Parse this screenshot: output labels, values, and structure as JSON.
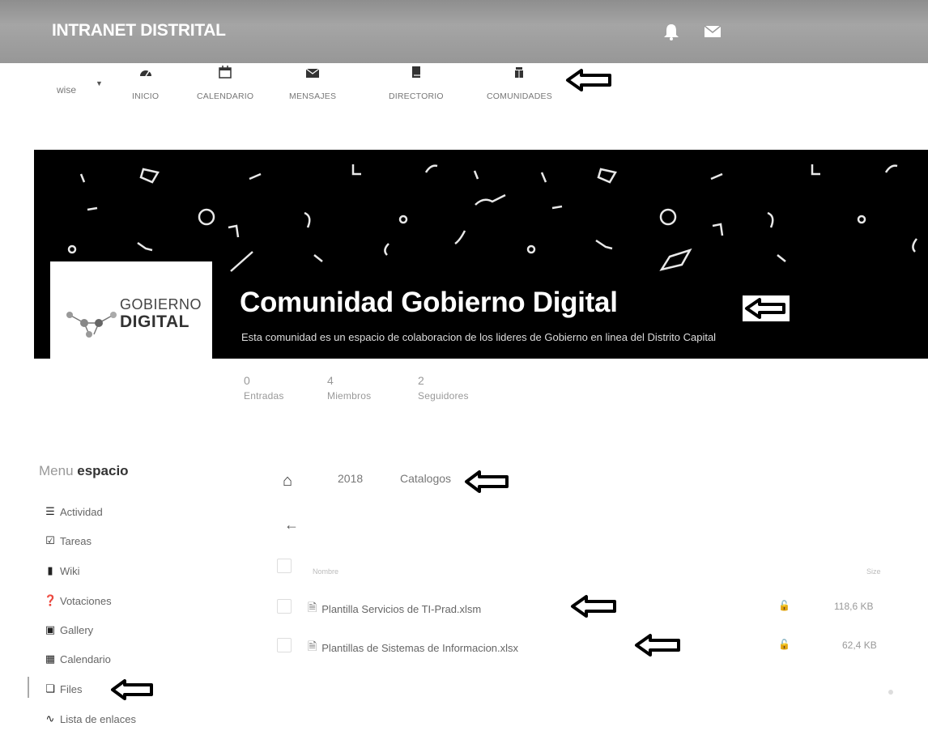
{
  "header": {
    "app_title": "INTRANET DISTRITAL"
  },
  "nav": {
    "user_label": "wise",
    "items": [
      {
        "label": "INICIO",
        "icon": "dashboard-icon"
      },
      {
        "label": "CALENDARIO",
        "icon": "calendar-icon"
      },
      {
        "label": "MENSAJES",
        "icon": "envelope-icon"
      },
      {
        "label": "DIRECTORIO",
        "icon": "book-icon"
      },
      {
        "label": "COMUNIDADES",
        "icon": "community-icon"
      }
    ]
  },
  "community": {
    "logo_line1": "GOBIERNO",
    "logo_line2": "DIGITAL",
    "title": "Comunidad Gobierno Digital",
    "description": "Esta comunidad es un espacio de colaboracion de los lideres de Gobierno en linea del Distrito Capital"
  },
  "stats": [
    {
      "value": "0",
      "label": "Entradas"
    },
    {
      "value": "4",
      "label": "Miembros"
    },
    {
      "value": "2",
      "label": "Seguidores"
    }
  ],
  "side_menu": {
    "title_prefix": "Menu ",
    "title_bold": "espacio",
    "items": [
      {
        "label": "Actividad",
        "icon": "list-icon"
      },
      {
        "label": "Tareas",
        "icon": "checkbox-icon"
      },
      {
        "label": "Wiki",
        "icon": "book-icon"
      },
      {
        "label": "Votaciones",
        "icon": "question-icon"
      },
      {
        "label": "Gallery",
        "icon": "image-icon"
      },
      {
        "label": "Calendario",
        "icon": "calendar-icon"
      },
      {
        "label": "Files",
        "icon": "files-icon"
      },
      {
        "label": "Lista de enlaces",
        "icon": "link-icon"
      }
    ]
  },
  "breadcrumb": [
    "2018",
    "Catalogos"
  ],
  "table": {
    "name_header": "Nombre",
    "size_header": "Size"
  },
  "files": [
    {
      "name": "Plantilla Servicios de TI-Prad.xlsm",
      "size": "118,6 KB"
    },
    {
      "name": "Plantillas de Sistemas de Informacion.xlsx",
      "size": "62,4 KB"
    }
  ],
  "colors": {
    "topbar": "#9a9a9a",
    "banner": "#000000",
    "annotation_arrow": "#000000"
  }
}
